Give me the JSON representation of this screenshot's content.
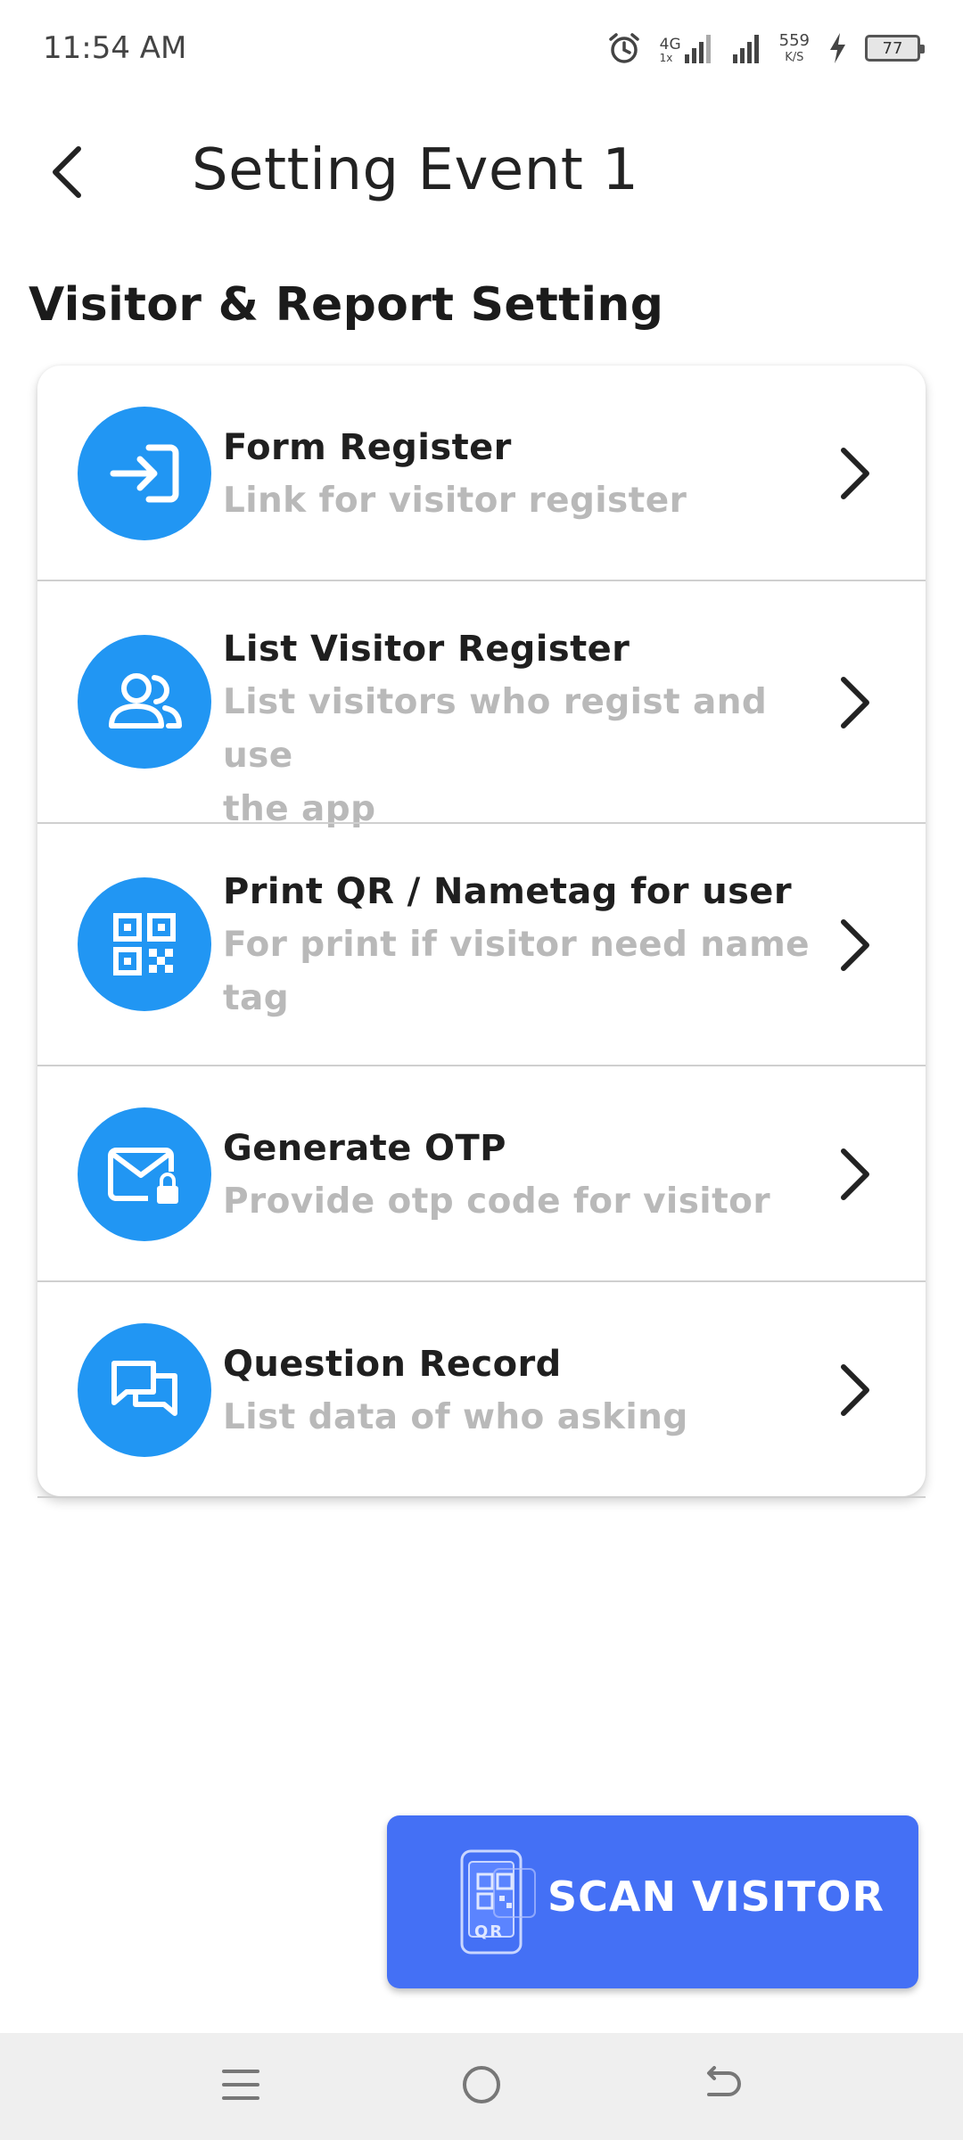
{
  "status_bar": {
    "time": "11:54 AM",
    "network": "4G",
    "network_sub": "1x",
    "speed_value": "559",
    "speed_unit": "K/S",
    "battery": "77",
    "icons": [
      "alarm-icon",
      "signal-4g-icon",
      "signal-icon",
      "charging-icon",
      "battery-icon"
    ]
  },
  "header": {
    "back_icon": "chevron-left-icon",
    "title": "Setting Event 1"
  },
  "section": {
    "title": "Visitor & Report Setting"
  },
  "menu": {
    "items": [
      {
        "icon": "login-icon",
        "title": "Form Register",
        "subtitle": "Link for visitor register"
      },
      {
        "icon": "users-icon",
        "title": "List Visitor Register",
        "subtitle_line1": "List visitors who regist and use",
        "subtitle_line2": "the app"
      },
      {
        "icon": "qr-code-icon",
        "title": "Print QR / Nametag for user",
        "subtitle_line1": "For print if visitor need name",
        "subtitle_line2": "tag"
      },
      {
        "icon": "mail-lock-icon",
        "title": "Generate OTP",
        "subtitle": "Provide otp code for visitor"
      },
      {
        "icon": "chat-icon",
        "title": "Question Record",
        "subtitle": "List data of who asking"
      }
    ]
  },
  "scan_button": {
    "label": "SCAN VISITOR",
    "icon_text": "QR"
  },
  "colors": {
    "icon_circle": "#2196f3",
    "scan_button": "#4470f5",
    "subtitle": "#b9b9b9"
  }
}
